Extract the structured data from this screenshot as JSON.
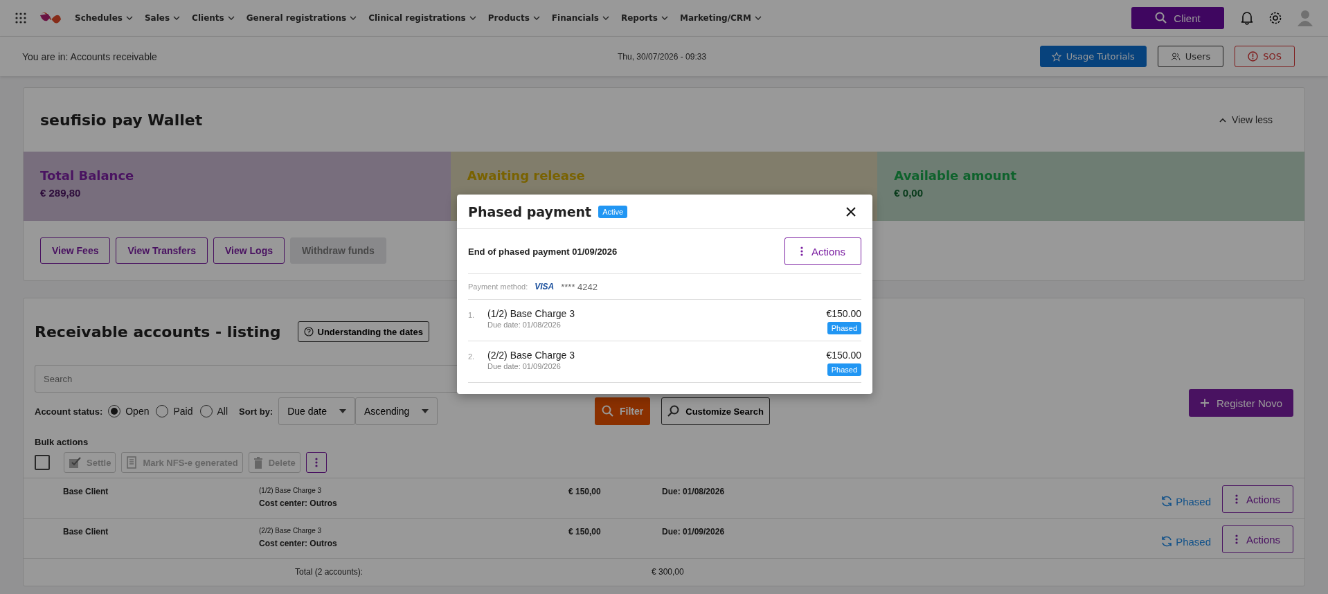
{
  "nav": {
    "items": [
      "Schedules",
      "Sales",
      "Clients",
      "General registrations",
      "Clinical registrations",
      "Products",
      "Financials",
      "Reports",
      "Marketing/CRM"
    ],
    "search_button": "Client"
  },
  "breadcrumb": "You are in: Accounts receivable",
  "datetime": "Thu, 30/07/2026 - 09:33",
  "header_buttons": [
    {
      "label": "Usage Tutorials",
      "kind": "primary"
    },
    {
      "label": "Users",
      "kind": "outline"
    },
    {
      "label": "SOS",
      "kind": "danger"
    }
  ],
  "wallet": {
    "title": "seufisio pay Wallet",
    "toggle": "View less",
    "balances": [
      {
        "label": "Total Balance",
        "amount": "€ 289,80",
        "color": "#4a1361"
      },
      {
        "label": "Awaiting release",
        "color": "#796200"
      },
      {
        "label": "Available amount",
        "amount": "€ 0,00",
        "color": "#0e622c"
      }
    ],
    "buttons": [
      {
        "label": "View Fees",
        "disabled": false
      },
      {
        "label": "View Transfers",
        "disabled": false
      },
      {
        "label": "View Logs",
        "disabled": false
      },
      {
        "label": "Withdraw funds",
        "disabled": true
      }
    ]
  },
  "listing": {
    "title": "Receivable accounts - listing",
    "help_button": "Understanding the dates",
    "search": {
      "placeholder": "Search"
    },
    "status_label": "Account status:",
    "statuses": [
      {
        "label": "Open",
        "selected": true
      },
      {
        "label": "Paid",
        "selected": false
      },
      {
        "label": "All",
        "selected": false
      }
    ],
    "sort_label": "Sort by:",
    "sort_selects": [
      "Due date",
      "Ascending"
    ],
    "filter_button": "Filter",
    "customize_button": "Customize Search",
    "register_button": "Register Novo",
    "bulk_label": "Bulk actions",
    "bulk_checked": false,
    "bulk_buttons": [
      {
        "label": "Settle",
        "kind": "settle",
        "disabled": true
      },
      {
        "label": "Mark NFS-e generated",
        "kind": "document",
        "disabled": true
      },
      {
        "label": "Delete",
        "kind": "delete",
        "disabled": true
      }
    ],
    "rows": [
      {
        "client": "Base Client",
        "description": "(1/2) Base Charge 3",
        "cost_center": "Cost center: Outros",
        "amount": "€ 150,00",
        "due": "Due: 01/08/2026",
        "status": "Phased",
        "action": "Actions"
      },
      {
        "client": "Base Client",
        "description": "(2/2) Base Charge 3",
        "cost_center": "Cost center: Outros",
        "amount": "€ 150,00",
        "due": "Due: 01/09/2026",
        "status": "Phased",
        "action": "Actions"
      }
    ],
    "total": {
      "label": "Total (2 accounts):",
      "amount": "€ 300,00"
    }
  },
  "modal": {
    "title": "Phased payment",
    "badge": "Active",
    "end_text": "End of phased payment 01/09/2026",
    "actions_button": "Actions",
    "payment_label": "Payment method:",
    "card_brand": "VISA",
    "card_number": "**** 4242",
    "installments": [
      {
        "number": "1.",
        "name": "(1/2) Base Charge 3",
        "due": "Due date: 01/08/2026",
        "amount": "€150.00",
        "status": "Phased"
      },
      {
        "number": "2.",
        "name": "(2/2) Base Charge 3",
        "due": "Due date: 01/09/2026",
        "amount": "€150.00",
        "status": "Phased"
      }
    ]
  }
}
